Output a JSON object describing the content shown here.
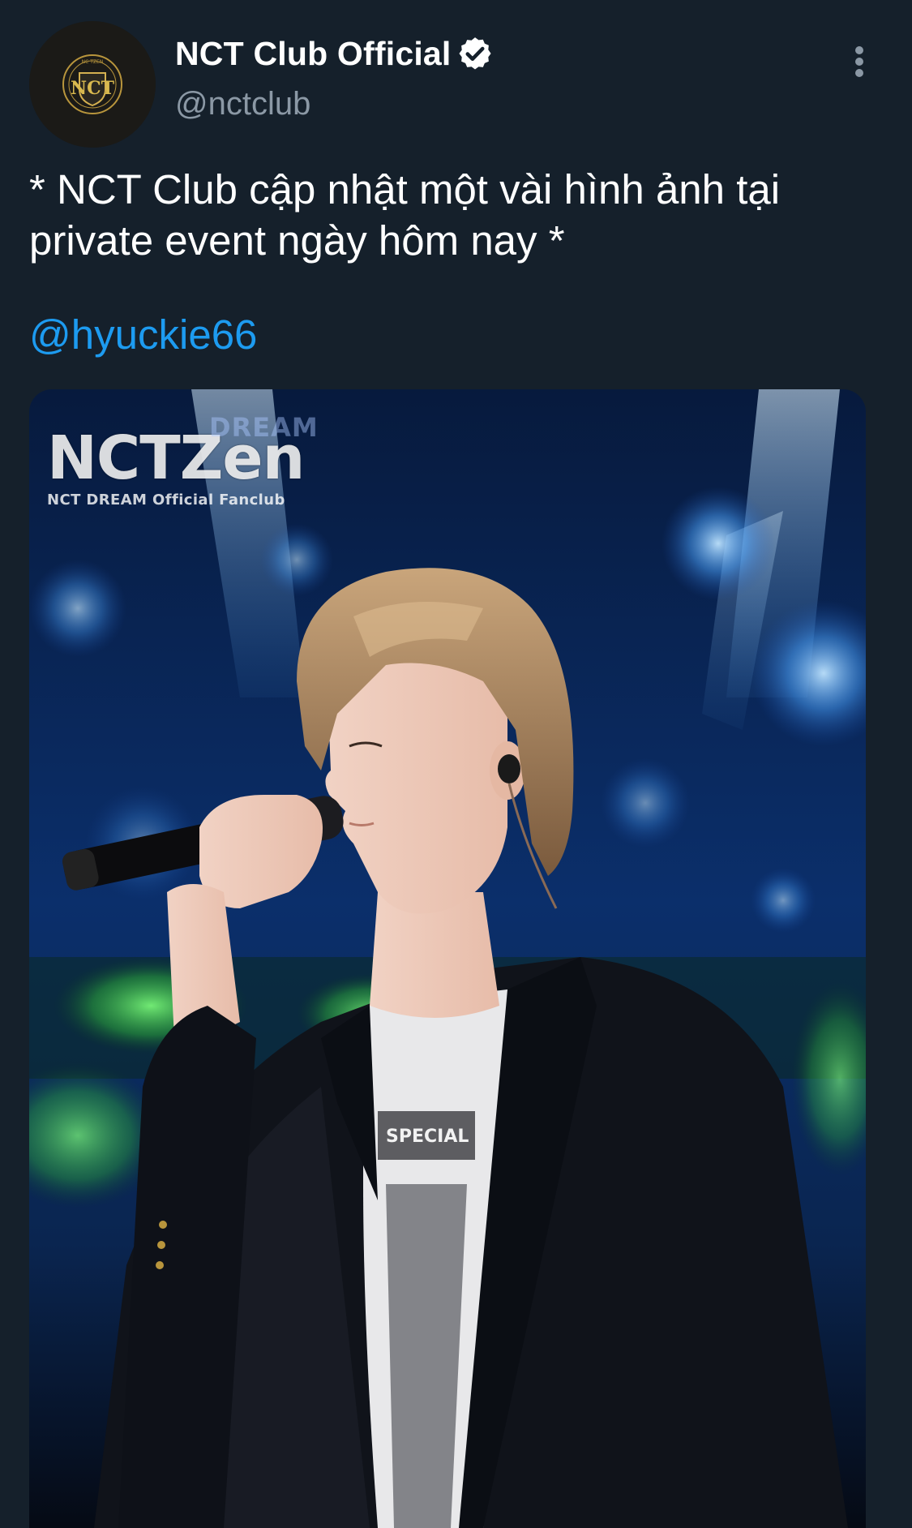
{
  "tweet": {
    "author": {
      "display_name": "NCT Club Official",
      "handle": "@nctclub",
      "verified": true,
      "avatar_icon": "nct-club-crest-logo",
      "avatar_logo_text": {
        "top": "NC TZEN",
        "initials": "NCT",
        "ring": "NCT CULTURE TECHNOLOGY"
      }
    },
    "text": "* NCT Club cập nhật một vài hình ảnh tại private event ngày hôm nay *",
    "mention": "@hyuckie66",
    "media": {
      "watermark": {
        "main": "NCTZen",
        "dream": "DREAM",
        "sub": "NCT DREAM Official Fanclub"
      },
      "shirt_print": "SPECIAL"
    },
    "menu_icon": "more-vertical-icon"
  },
  "colors": {
    "background": "#15202b",
    "text_primary": "#ffffff",
    "text_secondary": "#8b98a5",
    "link": "#1d9bf0",
    "verified_badge": "#ffffff"
  }
}
